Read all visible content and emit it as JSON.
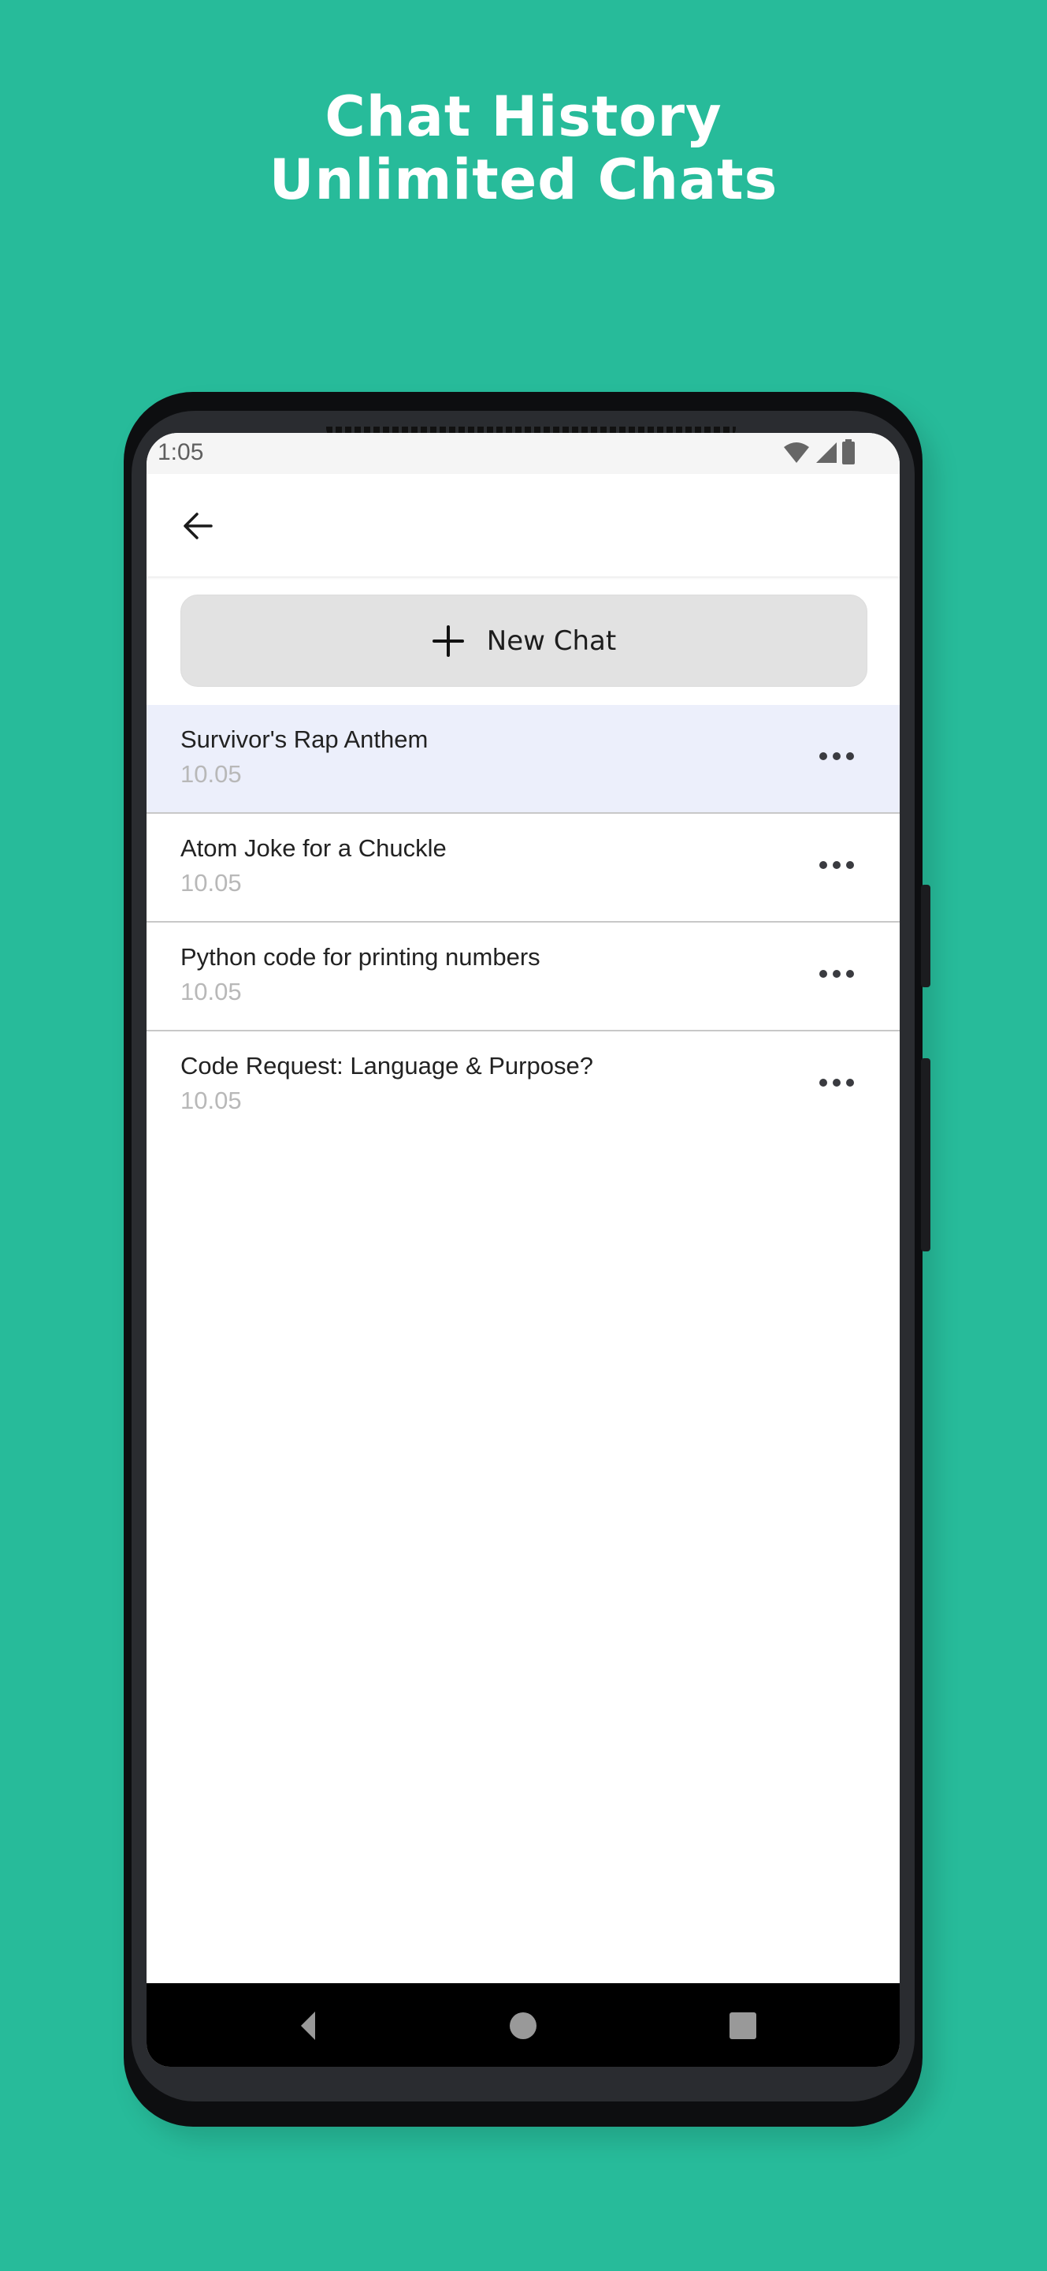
{
  "promo": {
    "line1": "Chat History",
    "line2": "Unlimited Chats",
    "background_color": "#27bb9a"
  },
  "status_bar": {
    "time": "1:05",
    "icons": [
      "wifi-icon",
      "cellular-signal-icon",
      "battery-icon"
    ]
  },
  "app_bar": {
    "back_icon": "arrow-left-icon"
  },
  "new_chat": {
    "icon": "plus-icon",
    "label": "New Chat"
  },
  "chats": [
    {
      "title": "Survivor's Rap Anthem",
      "date": "10.05",
      "selected": true
    },
    {
      "title": "Atom Joke for a Chuckle",
      "date": "10.05",
      "selected": false
    },
    {
      "title": "Python code for printing numbers",
      "date": "10.05",
      "selected": false
    },
    {
      "title": "Code Request: Language & Purpose?",
      "date": "10.05",
      "selected": false
    }
  ],
  "nav_bar": {
    "buttons": [
      "back-triangle-icon",
      "home-circle-icon",
      "recents-square-icon"
    ]
  },
  "colors": {
    "selected_row": "#eceffb",
    "date_text": "#b8b8b8",
    "button_bg": "#e2e2e2"
  }
}
